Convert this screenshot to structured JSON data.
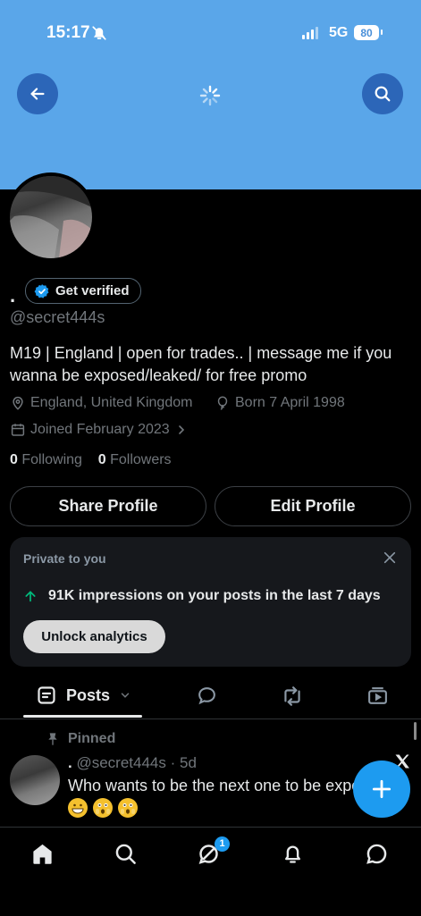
{
  "status_bar": {
    "time": "15:17",
    "network": "5G",
    "battery": "80"
  },
  "profile": {
    "display_name": ".",
    "verify_label": "Get verified",
    "handle": "@secret444s",
    "bio": "M19 | England | open for trades.. | message me if you wanna be exposed/leaked/ for free promo",
    "location": "England, United Kingdom",
    "born": "Born 7 April 1998",
    "joined": "Joined February 2023",
    "following_count": "0",
    "following_label": "Following",
    "followers_count": "0",
    "followers_label": "Followers"
  },
  "actions": {
    "share_label": "Share Profile",
    "edit_label": "Edit Profile"
  },
  "analytics_card": {
    "title": "Private to you",
    "stat": "91K impressions on your posts in the last 7 days",
    "button_label": "Unlock analytics"
  },
  "tabs": {
    "active_label": "Posts",
    "icons": [
      "posts-icon",
      "replies-icon",
      "reposts-icon",
      "media-icon"
    ]
  },
  "post": {
    "pinned_label": "Pinned",
    "name": ".",
    "handle_time": "@secret444s · 5d",
    "text": "Who wants to be the next one to be exposed?",
    "emojis": [
      "grinning-face",
      "astonished-face",
      "astonished-face"
    ]
  },
  "bottom_nav": {
    "items": [
      "home-icon",
      "search-icon",
      "spaces-icon",
      "notifications-icon",
      "messages-icon"
    ],
    "badge": "1"
  },
  "colors": {
    "banner": "#5aa6e9",
    "accent": "#1d9bf0",
    "background": "#000000",
    "muted": "#71767b"
  }
}
